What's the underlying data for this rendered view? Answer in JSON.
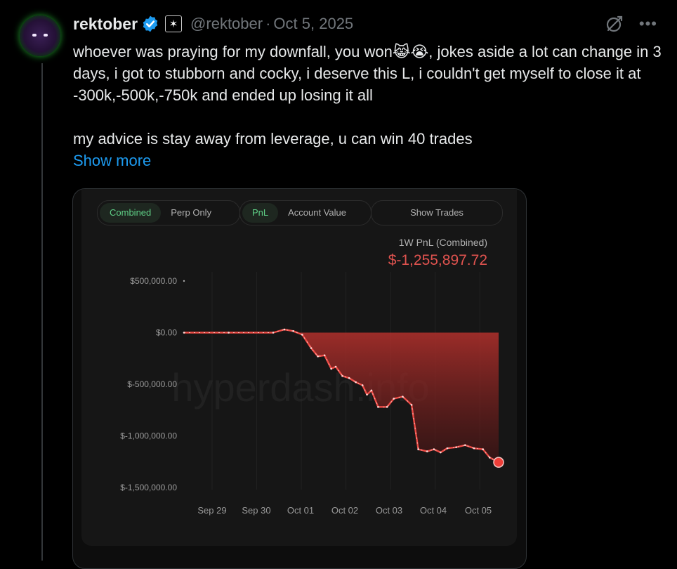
{
  "author": {
    "name": "rektober",
    "handle": "@rektober",
    "separator": "·",
    "date": "Oct 5, 2025"
  },
  "icons": {
    "verified": "verified-badge-icon",
    "affiliate": "affiliate-badge-icon",
    "grok": "grok-icon",
    "more": "more-icon"
  },
  "colors": {
    "verified_blue": "#1d9bf0",
    "link_blue": "#1d9bf0",
    "loss_red": "#e0534f",
    "active_green": "#5fcf86"
  },
  "tweet": {
    "text_p1": "whoever was praying for my downfall, you won😹😭, jokes aside a lot can change in 3 days, i got to stubborn and cocky, i deserve this L, i couldn't get myself to close it at -300k,-500k,-750k and ended up losing it all",
    "text_p2": "my advice is stay away from leverage, u can win 40 trades",
    "show_more": "Show more"
  },
  "card": {
    "toggles": {
      "scope": [
        "Combined",
        "Perp Only"
      ],
      "scope_active": "Combined",
      "metric": [
        "PnL",
        "Account Value"
      ],
      "metric_active": "PnL",
      "show_trades": "Show Trades"
    },
    "pnl_title": "1W PnL (Combined)",
    "pnl_value": "$-1,255,897.72",
    "watermark": "hyperdash.info"
  },
  "chart_data": {
    "type": "area",
    "title": "1W PnL (Combined)",
    "x": [
      "Sep 29",
      "Sep 30",
      "Oct 01",
      "Oct 02",
      "Oct 03",
      "Oct 04",
      "Oct 05"
    ],
    "yticks": [
      "$500,000.00",
      "$0.00",
      "$-500,000.00",
      "$-1,000,000.00",
      "$-1,500,000.00"
    ],
    "ylim": [
      -1500000,
      500000
    ],
    "xlim": [
      0,
      7.05
    ],
    "grid": true,
    "series": [
      {
        "points": [
          [
            0,
            0
          ],
          [
            1,
            0
          ],
          [
            2,
            0
          ],
          [
            2.25,
            30000
          ],
          [
            2.45,
            15000
          ],
          [
            2.65,
            -20000
          ],
          [
            2.85,
            -150000
          ],
          [
            3.0,
            -230000
          ],
          [
            3.15,
            -220000
          ],
          [
            3.3,
            -350000
          ],
          [
            3.4,
            -330000
          ],
          [
            3.55,
            -420000
          ],
          [
            3.7,
            -440000
          ],
          [
            3.85,
            -480000
          ],
          [
            4.0,
            -510000
          ],
          [
            4.1,
            -600000
          ],
          [
            4.2,
            -560000
          ],
          [
            4.35,
            -720000
          ],
          [
            4.55,
            -720000
          ],
          [
            4.7,
            -640000
          ],
          [
            4.9,
            -620000
          ],
          [
            5.1,
            -700000
          ],
          [
            5.25,
            -1130000
          ],
          [
            5.45,
            -1150000
          ],
          [
            5.6,
            -1130000
          ],
          [
            5.75,
            -1160000
          ],
          [
            5.9,
            -1120000
          ],
          [
            6.1,
            -1110000
          ],
          [
            6.3,
            -1090000
          ],
          [
            6.5,
            -1120000
          ],
          [
            6.7,
            -1130000
          ],
          [
            6.85,
            -1210000
          ],
          [
            7.05,
            -1255897.72
          ]
        ]
      }
    ]
  }
}
